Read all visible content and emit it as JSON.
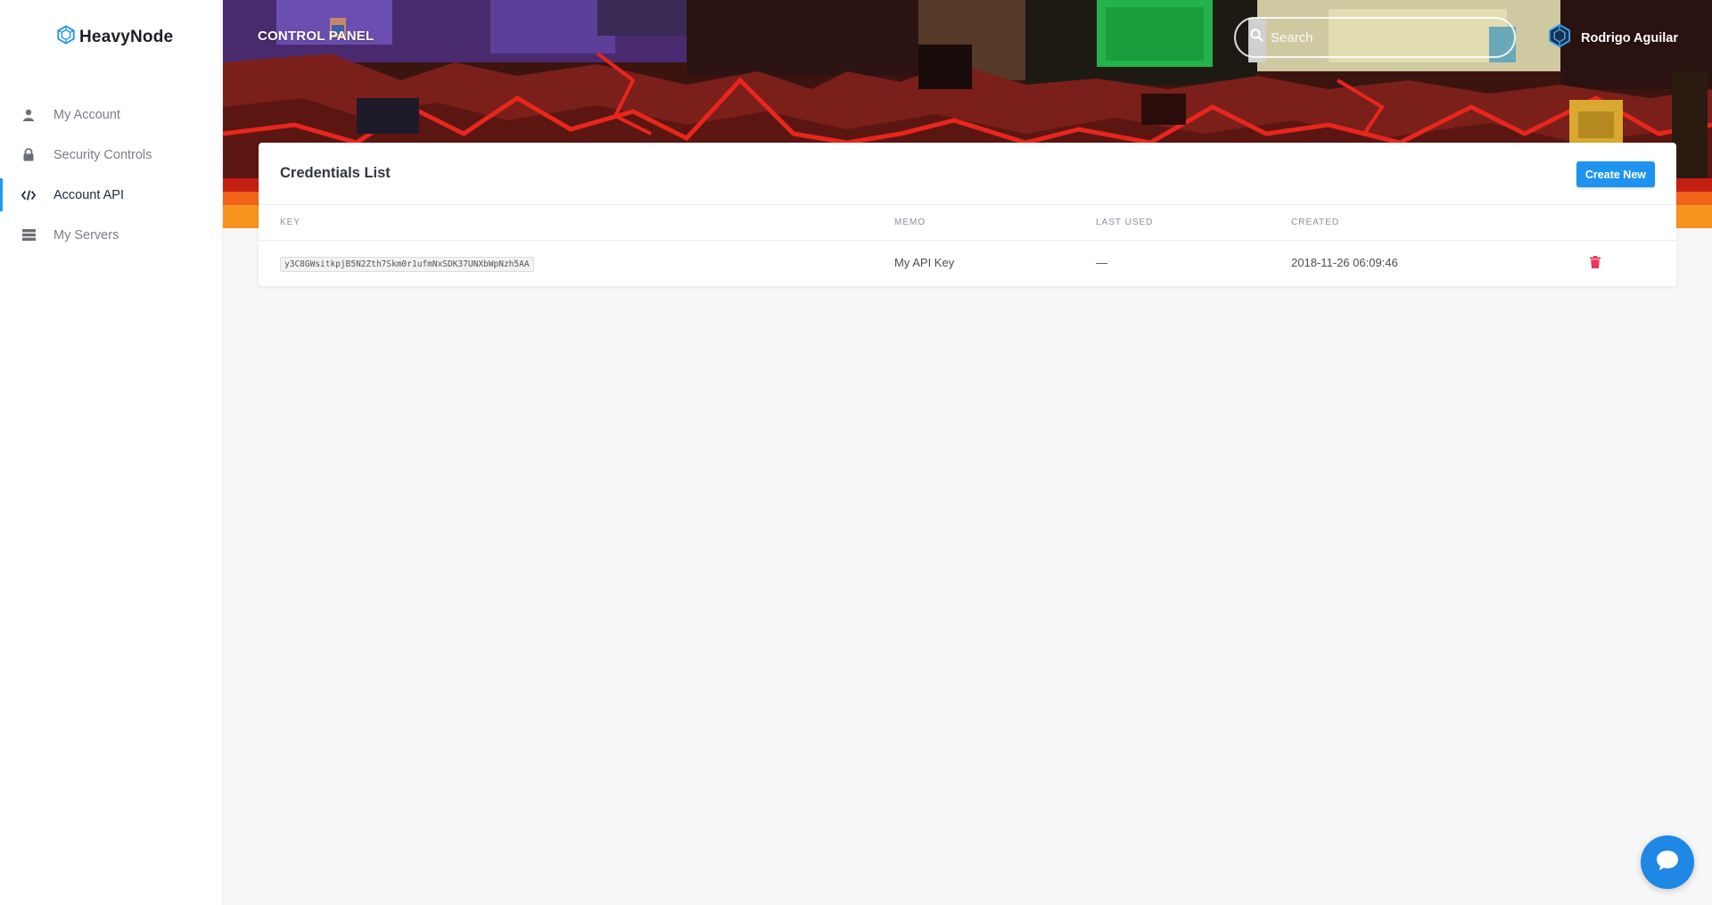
{
  "brand": {
    "name": "HeavyNode"
  },
  "sidebar": {
    "items": [
      {
        "label": "My Account",
        "icon": "user-icon"
      },
      {
        "label": "Security Controls",
        "icon": "lock-icon"
      },
      {
        "label": "Account API",
        "icon": "code-icon",
        "active": true
      },
      {
        "label": "My Servers",
        "icon": "servers-icon"
      }
    ]
  },
  "header": {
    "title": "CONTROL PANEL",
    "search_placeholder": "Search",
    "user_name": "Rodrigo Aguilar"
  },
  "credentials": {
    "title": "Credentials List",
    "create_label": "Create New",
    "columns": [
      "KEY",
      "MEMO",
      "LAST USED",
      "CREATED"
    ],
    "rows": [
      {
        "key": "y3C8GWsitkpjB5N2Zth7Skm0r1ufmNxSDK37UNXbWpNzh5AA",
        "memo": "My API Key",
        "last_used": "—",
        "created": "2018-11-26 06:09:46"
      }
    ]
  },
  "colors": {
    "accent": "#1e94f0",
    "danger": "#f0345a",
    "banner_lava": "#e8261c",
    "banner_dark": "#3b1410"
  }
}
